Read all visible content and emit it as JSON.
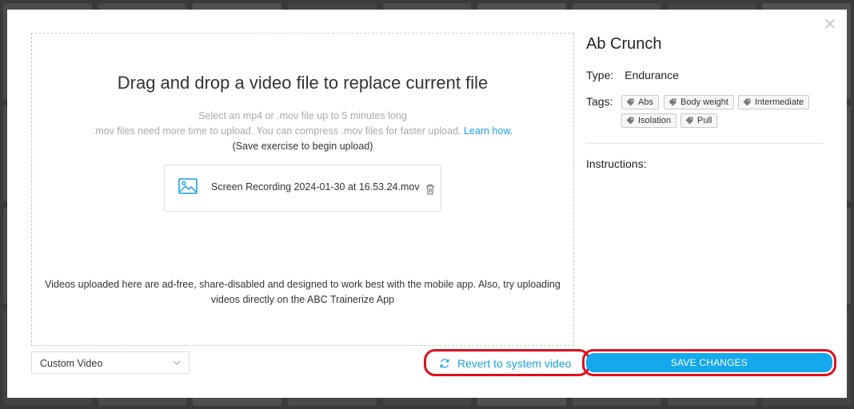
{
  "dropzone": {
    "title": "Drag and drop a video file to replace current file",
    "subtitle_line1": "Select an mp4 or .mov file up to 5 minutes long",
    "subtitle_line2": ".mov files need more time to upload. You can compress .mov files for faster upload.",
    "learn_link": "Learn how.",
    "save_hint": "(Save exercise to begin upload)",
    "file_name": "Screen Recording 2024-01-30 at 16.53.24.mov",
    "note_line1": "Videos uploaded here are ad-free, share-disabled and designed to work best with the mobile app. Also, try uploading",
    "note_line2": "videos directly on the ABC Trainerize App"
  },
  "video_source": {
    "selected": "Custom Video"
  },
  "actions": {
    "revert_label": "Revert to system video",
    "save_label": "SAVE CHANGES"
  },
  "exercise": {
    "name": "Ab Crunch",
    "type_label": "Type:",
    "type_value": "Endurance",
    "tags_label": "Tags:",
    "tags": [
      "Abs",
      "Body weight",
      "Intermediate",
      "Isolation",
      "Pull"
    ],
    "instructions_label": "Instructions:"
  },
  "icons": {
    "close": "close-icon",
    "image": "image-icon",
    "trash": "trash-icon",
    "chevron": "chevron-down-icon",
    "revert": "refresh-icon",
    "tag": "tag-icon"
  },
  "colors": {
    "accent": "#14a8ec",
    "link": "#1a9fe0",
    "highlight": "#e0101e"
  }
}
